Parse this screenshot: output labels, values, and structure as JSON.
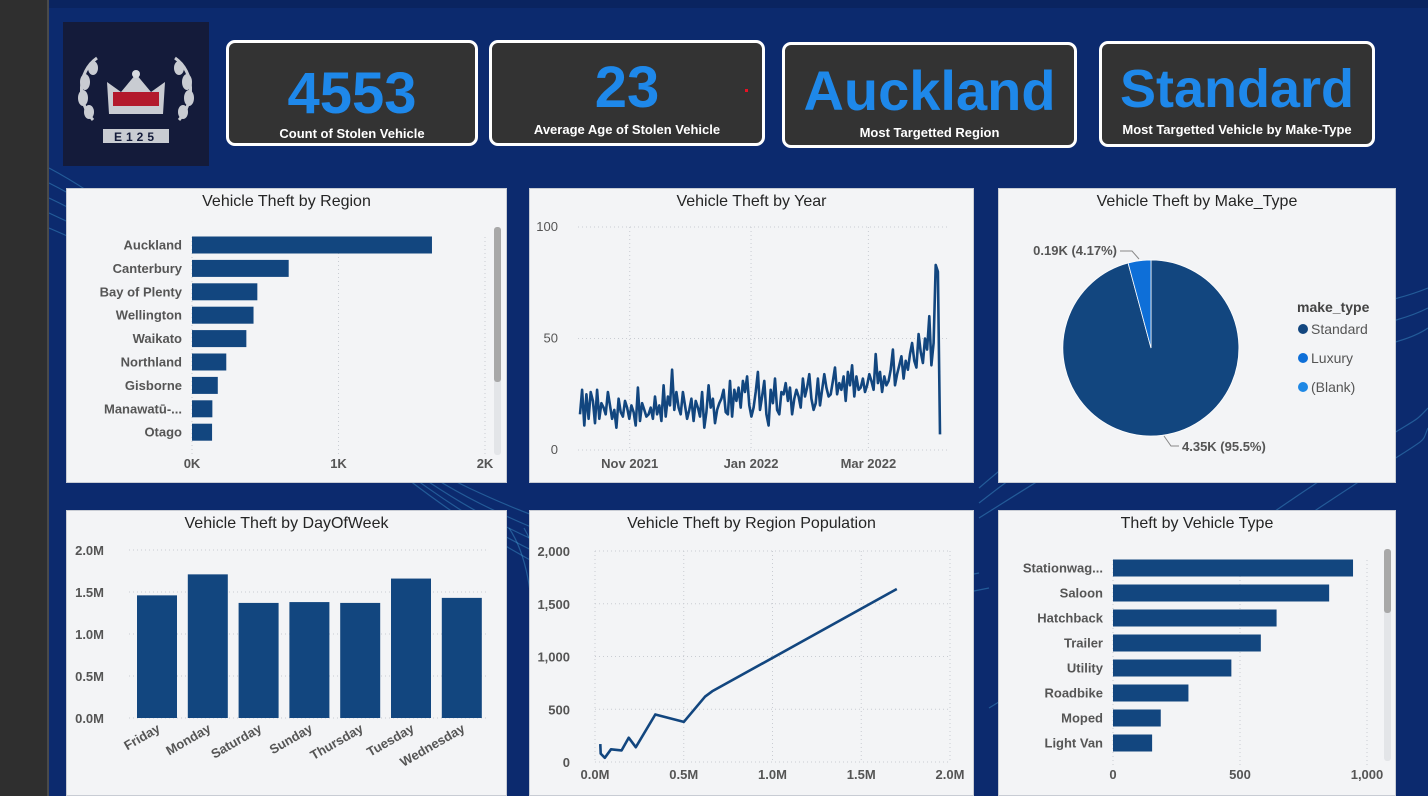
{
  "kpis": [
    {
      "value": "4553",
      "label": "Count of Stolen Vehicle"
    },
    {
      "value": "23",
      "label": "Average Age of Stolen Vehicle"
    },
    {
      "value": "Auckland",
      "label": "Most Targetted Region"
    },
    {
      "value": "Standard",
      "label": "Most Targetted Vehicle by Make-Type"
    }
  ],
  "logo": {
    "text": "E125"
  },
  "colors": {
    "bar": "#12467f",
    "accent": "#1e88ea",
    "kpi_bg": "#333333",
    "page_bg": "#0c2a6e",
    "luxury": "#0e6fd8",
    "blank": "#1e88e5"
  },
  "chart_data": [
    {
      "type": "bar",
      "orientation": "horizontal",
      "title": "Vehicle Theft by Region",
      "categories": [
        "Auckland",
        "Canterbury",
        "Bay of Plenty",
        "Wellington",
        "Waikato",
        "Northland",
        "Gisborne",
        "Manawatū-...",
        "Otago"
      ],
      "values": [
        1638,
        660,
        446,
        420,
        371,
        234,
        176,
        139,
        137
      ],
      "xlim": [
        0,
        2000
      ],
      "xticks": [
        "0K",
        "1K",
        "2K"
      ]
    },
    {
      "type": "line",
      "title": "Vehicle Theft by Year",
      "x_ticks": [
        "Nov 2021",
        "Jan 2022",
        "Mar 2022"
      ],
      "yticks": [
        "0",
        "50",
        "100"
      ],
      "ylim": [
        0,
        100
      ],
      "date_range": [
        "2021-10-07",
        "2022-04-06"
      ],
      "values": [
        16,
        27,
        11,
        25,
        14,
        26,
        22,
        12,
        27,
        14,
        21,
        19,
        16,
        26,
        20,
        14,
        18,
        10,
        23,
        17,
        15,
        22,
        19,
        14,
        20,
        17,
        11,
        28,
        13,
        21,
        18,
        15,
        16,
        19,
        14,
        24,
        16,
        20,
        13,
        29,
        15,
        24,
        20,
        36,
        18,
        26,
        19,
        16,
        26,
        20,
        14,
        18,
        23,
        13,
        22,
        19,
        15,
        26,
        10,
        17,
        29,
        19,
        23,
        12,
        18,
        21,
        23,
        27,
        17,
        16,
        31,
        15,
        27,
        22,
        28,
        19,
        31,
        26,
        33,
        20,
        15,
        19,
        26,
        35,
        18,
        24,
        31,
        16,
        11,
        27,
        21,
        32,
        18,
        16,
        26,
        25,
        30,
        22,
        28,
        16,
        23,
        27,
        24,
        19,
        32,
        24,
        28,
        34,
        23,
        18,
        21,
        32,
        20,
        27,
        34,
        28,
        24,
        25,
        31,
        37,
        25,
        30,
        27,
        33,
        22,
        35,
        29,
        38,
        24,
        33,
        27,
        28,
        32,
        26,
        29,
        34,
        31,
        27,
        43,
        30,
        35,
        26,
        33,
        29,
        31,
        36,
        45,
        29,
        34,
        38,
        42,
        32,
        40,
        36,
        43,
        48,
        40,
        37,
        52,
        44,
        39,
        50,
        45,
        60,
        38,
        48,
        83,
        80,
        7
      ]
    },
    {
      "type": "pie",
      "title": "Vehicle Theft by Make_Type",
      "legend_title": "make_type",
      "categories": [
        "Standard",
        "Luxury",
        "(Blank)"
      ],
      "values": [
        4350,
        190,
        0
      ],
      "labels": [
        "4.35K (95.5%)",
        "0.19K (4.17%)"
      ]
    },
    {
      "type": "bar",
      "title": "Vehicle Theft by DayOfWeek",
      "categories": [
        "Friday",
        "Monday",
        "Saturday",
        "Sunday",
        "Thursday",
        "Tuesday",
        "Wednesday"
      ],
      "values": [
        1460000,
        1710000,
        1370000,
        1380000,
        1370000,
        1660000,
        1430000
      ],
      "ylim": [
        0,
        2000000
      ],
      "yticks": [
        "0.0M",
        "0.5M",
        "1.0M",
        "1.5M",
        "2.0M"
      ]
    },
    {
      "type": "line",
      "title": "Vehicle Theft by Region Population",
      "xticks": [
        "0.0M",
        "0.5M",
        "1.0M",
        "1.5M",
        "2.0M"
      ],
      "yticks": [
        "0",
        "500",
        "1,000",
        "1,500",
        "2,000"
      ],
      "xlim": [
        0,
        2000000
      ],
      "ylim": [
        0,
        2000
      ],
      "points": [
        [
          30000,
          170
        ],
        [
          32000,
          80
        ],
        [
          55000,
          40
        ],
        [
          90000,
          120
        ],
        [
          150000,
          110
        ],
        [
          190000,
          230
        ],
        [
          230000,
          140
        ],
        [
          340000,
          450
        ],
        [
          500000,
          380
        ],
        [
          620000,
          620
        ],
        [
          660000,
          670
        ],
        [
          1700000,
          1640
        ]
      ]
    },
    {
      "type": "bar",
      "orientation": "horizontal",
      "title": "Theft by Vehicle Type",
      "categories": [
        "Stationwag...",
        "Saloon",
        "Hatchback",
        "Trailer",
        "Utility",
        "Roadbike",
        "Moped",
        "Light Van"
      ],
      "values": [
        945,
        851,
        644,
        582,
        466,
        297,
        188,
        154
      ],
      "xlim": [
        0,
        1000
      ],
      "xticks": [
        "0",
        "500",
        "1,000"
      ]
    }
  ]
}
